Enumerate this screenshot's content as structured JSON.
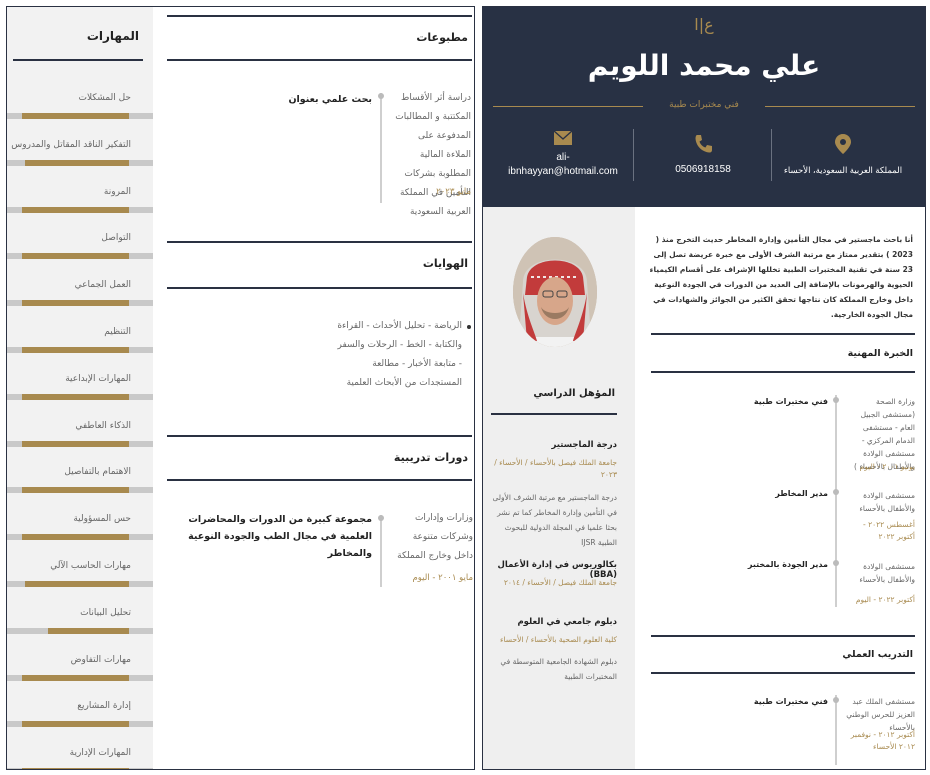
{
  "colors": {
    "navy": "#283144",
    "gold": "#a88a4f",
    "sidebar": "#efefef"
  },
  "skills": {
    "title": "المهارات",
    "items": [
      {
        "name": "حل المشكلات",
        "level": 0.88
      },
      {
        "name": "التفكير الناقد المقاتل والمدروس",
        "level": 0.85
      },
      {
        "name": "المرونة",
        "level": 0.88
      },
      {
        "name": "التواصل",
        "level": 0.88
      },
      {
        "name": "العمل الجماعي",
        "level": 0.88
      },
      {
        "name": "التنظيم",
        "level": 0.88
      },
      {
        "name": "المهارات الإبداعية",
        "level": 0.88
      },
      {
        "name": "الذكاء العاطفي",
        "level": 0.88
      },
      {
        "name": "الاهتمام بالتفاصيل",
        "level": 0.88
      },
      {
        "name": "حس المسؤولية",
        "level": 0.88
      },
      {
        "name": "مهارات الحاسب الآلي",
        "level": 0.85
      },
      {
        "name": "تحليل البيانات",
        "level": 0.66
      },
      {
        "name": "مهارات التفاوض",
        "level": 0.88
      },
      {
        "name": "إدارة المشاريع",
        "level": 0.88
      },
      {
        "name": "المهارات الإدارية",
        "level": 0.88
      }
    ]
  },
  "publications": {
    "title": "مطبوعات",
    "desc": "دراسة أثر الأقساط المكتتبة و المطالبات المدفوعة على الملاءة المالية المطلوبة بشركات التأمين في المملكة العربية السعودية",
    "head": "بحث علمي بعنوان",
    "date": "مايو ٢٠٢٣"
  },
  "hobbies": {
    "title": "الهوايات",
    "text": "الرياضة - تحليل الأحداث - القراءة والكتابة - الخط - الرحلات والسفر - متابعة الأخبار - مطالعة المستجدات من الأبحاث العلمية"
  },
  "courses": {
    "title": "دورات تدريبية",
    "desc": "وزارات وإدارات وشركات متنوعة داخل وخارج المملكة",
    "head": "مجموعة كبيرة من الدورات والمحاضرات العلمية في مجال الطب والجودة النوعية والمخاطر",
    "date": "مايو ٢٠٠١ - اليوم"
  },
  "header": {
    "monogram": "ع|ا",
    "name": "علي محمد اللويم",
    "job_title": "فني مختبرات طبية",
    "location": "المملكة العربية السعودية، الأحساء",
    "phone": "0506918158",
    "email_1": "ali-",
    "email_2": "ibnhayyan@hotmail.com"
  },
  "summary": "أنا باحث ماجستير في مجال التأمين وإدارة المخاطر حديث التخرج منذ ( 2023 ) بتقدير ممتاز مع مرتبة الشرف الأولى مع خبرة عريضة تصل إلى 23 سنة في تقنية المختبرات الطبية تخللها الإشراف على أقسام الكيمياء الحيوية والهرمونات بالإضافة إلى العديد من الدورات في الجودة النوعية داخل وخارج المملكة كان نتاجها تحقق الكثير من الجوائز والشهادات في مجال الجودة الخارجية.",
  "education": {
    "title": "المؤهل الدراسي",
    "items": [
      {
        "head": "درجة الماجستير",
        "sub": "جامعة الملك فيصل بالأحساء / الأحساء / ٢٠٢٣",
        "desc": "درجة الماجستير مع مرتبة الشرف الأولى في التأمين وإدارة المخاطر كما تم نشر بحثا علميا في المجلة الدولية للبحوث الطبية IJSR"
      },
      {
        "head": "بكالوريوس في إدارة الأعمال (BBA)",
        "sub": "جامعة الملك فيصل / الأحساء / ٢٠١٤",
        "desc": ""
      },
      {
        "head": "دبلوم جامعي في العلوم",
        "sub": "كلية العلوم الصحية بالأحساء / الأحساء",
        "desc": "دبلوم الشهادة الجامعية المتوسطة في المختبرات الطبية"
      }
    ]
  },
  "experience": {
    "title": "الخبرة المهنية",
    "items": [
      {
        "desc": "وزارة الصحة (مستشفى الجبيل العام - مستشفى الدمام المركزي - مستشفى الولادة والأطفال بالأحساء )",
        "head": "فني مختبرات طبية",
        "date": "يونيو ٢٠٠١ - اليوم"
      },
      {
        "desc": "مستشفى الولادة والأطفال بالأحساء",
        "head": "مدير المخاطر",
        "date": "أغسطس ٢٠٢٢ - أكتوبر ٢٠٢٢"
      },
      {
        "desc": "مستشفى الولادة والأطفال بالأحساء",
        "head": "مدير الجودة بالمختبر",
        "date": "أكتوبر ٢٠٢٢ - اليوم"
      }
    ]
  },
  "training": {
    "title": "التدريب العملي",
    "items": [
      {
        "desc": "مستشفى الملك عبد العزيز للحرس الوطني بالأحساء",
        "head": "فني مختبرات طبية",
        "date": "أكتوبر ٢٠١٢ - نوفمبر ٢٠١٢ الأحساء"
      }
    ]
  }
}
